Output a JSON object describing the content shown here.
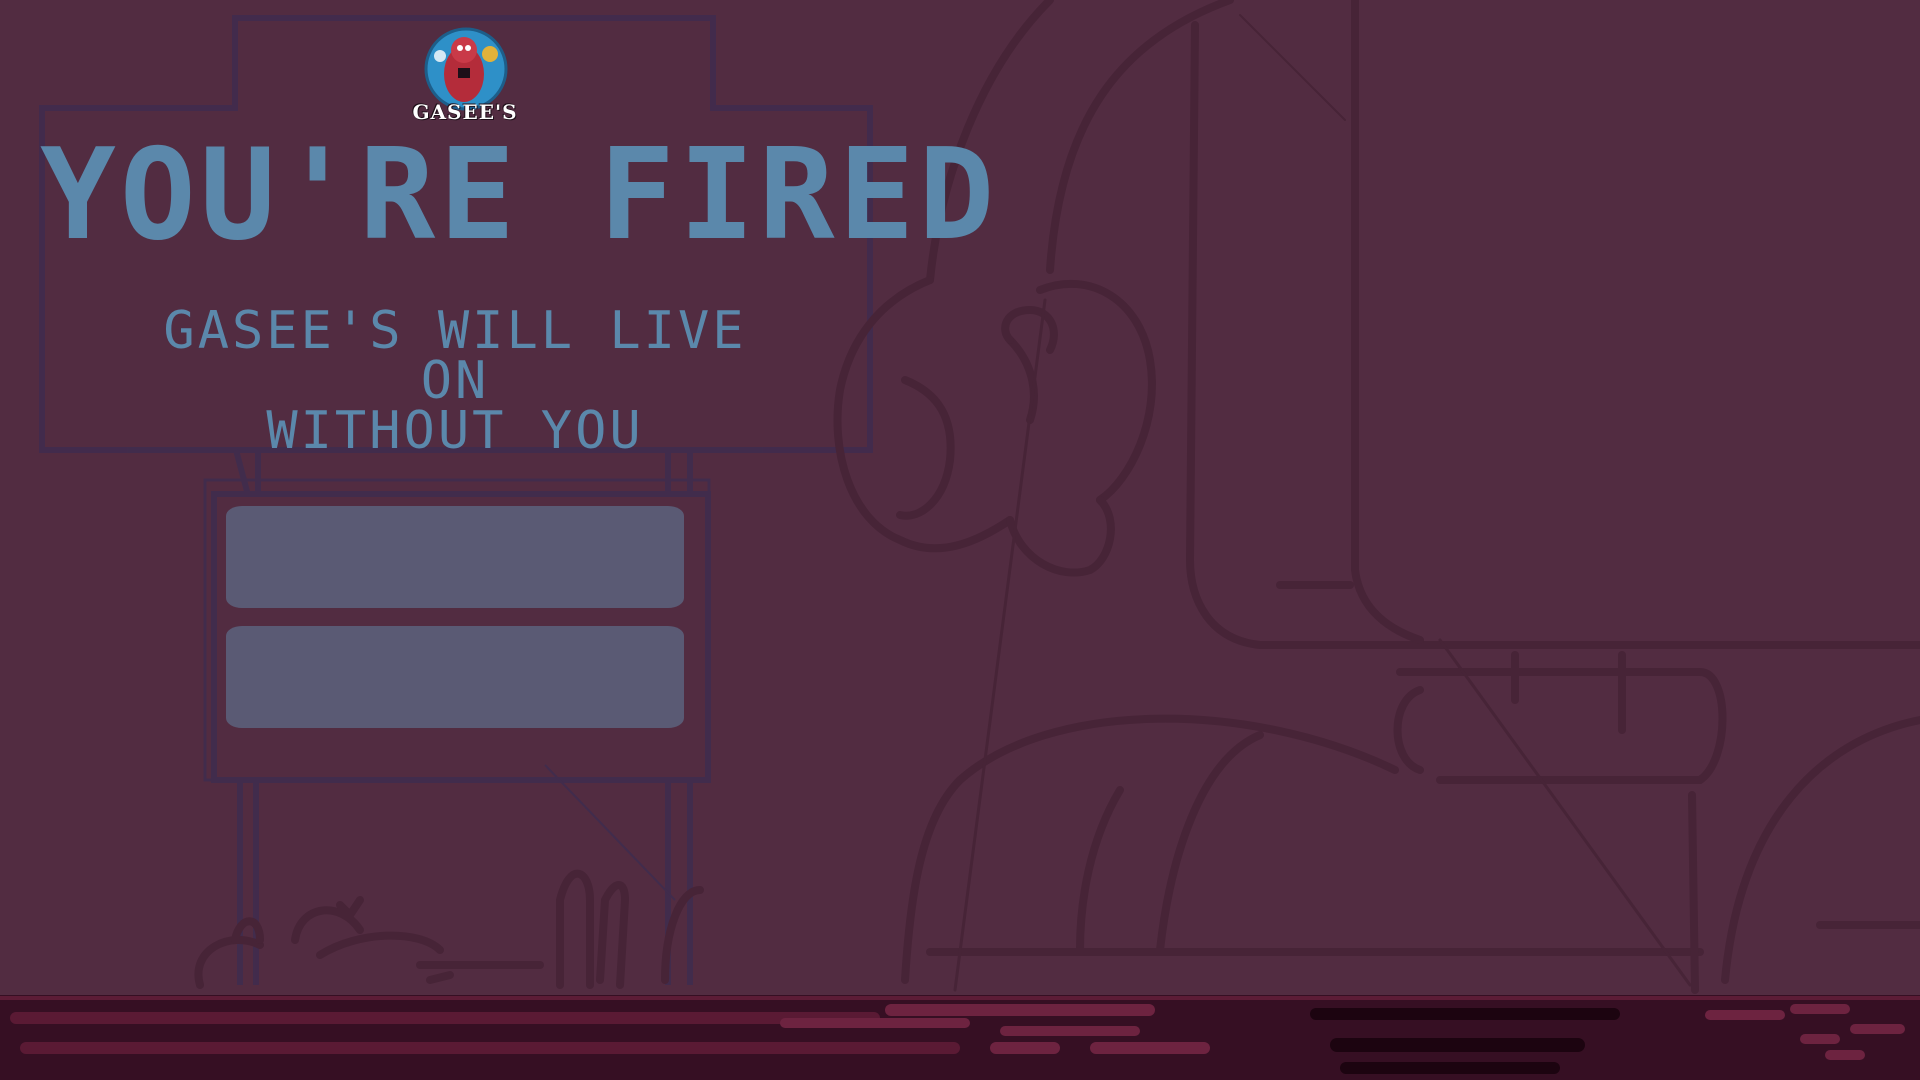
{
  "logo": {
    "text": "GASEE'S",
    "icon": "gasee-mascot-logo"
  },
  "gameover": {
    "title": "YOU'RE FIRED",
    "subtitle_line1": "GASEE'S WILL LIVE ON",
    "subtitle_line2": "WITHOUT YOU"
  },
  "menu": {
    "buttons": [
      {
        "label": ""
      },
      {
        "label": ""
      }
    ]
  },
  "colors": {
    "background": "#522c41",
    "title_text": "#5b88ab",
    "button_fill": "#5a5a74",
    "sketch_lines": "#472437",
    "sign_frame": "#3e2b4e",
    "floor_dark": "#2f0f20",
    "floor_stripe": "#6d2340"
  }
}
